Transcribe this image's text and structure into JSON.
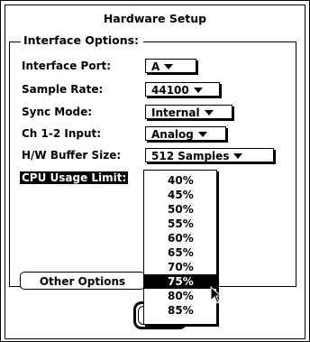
{
  "dialog": {
    "title": "Hardware Setup",
    "group_label": "Interface Options:"
  },
  "fields": [
    {
      "label": "Interface Port:",
      "value": "A"
    },
    {
      "label": "Sample Rate:",
      "value": "44100"
    },
    {
      "label": "Sync Mode:",
      "value": "Internal"
    },
    {
      "label": "Ch 1-2 Input:",
      "value": "Analog"
    },
    {
      "label": "H/W Buffer Size:",
      "value": "512 Samples"
    },
    {
      "label": "CPU Usage Limit:"
    }
  ],
  "cpu_menu": {
    "options": [
      "40%",
      "45%",
      "50%",
      "55%",
      "60%",
      "65%",
      "70%",
      "75%",
      "80%",
      "85%"
    ],
    "highlighted": "75%"
  },
  "buttons": {
    "other_options": "Other Options"
  },
  "icons": {
    "popup_arrow": "triangle-down",
    "cursor": "arrow-pointer"
  }
}
